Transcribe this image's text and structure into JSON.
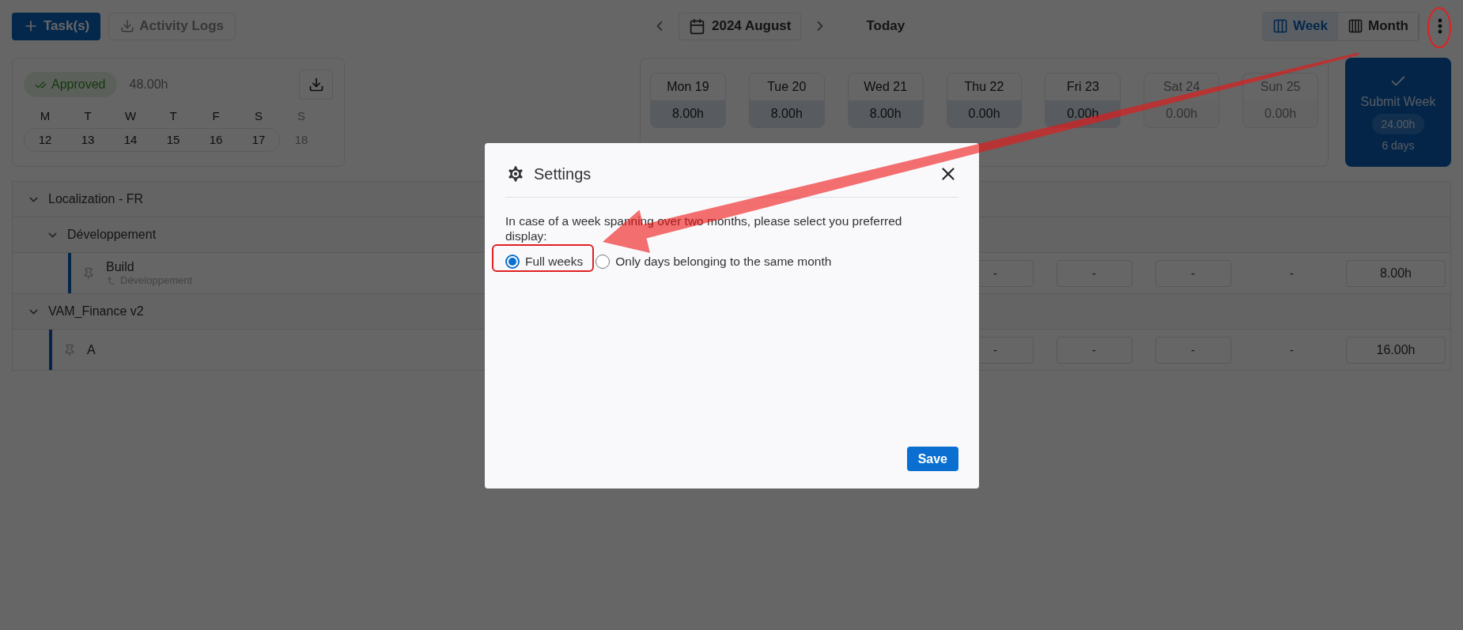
{
  "toolbar": {
    "add_button": "Task(s)",
    "logs_button": {
      "label": "Activity Logs",
      "disabled": true
    }
  },
  "date_nav": {
    "period": "2024 August",
    "today": "Today"
  },
  "views": [
    {
      "label": "Week",
      "selected": true
    },
    {
      "label": "Month",
      "selected": false
    }
  ],
  "summary": {
    "status": "Approved",
    "total": "48.00h",
    "weekdays": [
      {
        "letter": "M",
        "date": "12",
        "disabled": false
      },
      {
        "letter": "T",
        "date": "13",
        "disabled": false
      },
      {
        "letter": "W",
        "date": "14",
        "disabled": false
      },
      {
        "letter": "T",
        "date": "15",
        "disabled": false
      },
      {
        "letter": "F",
        "date": "16",
        "disabled": false
      },
      {
        "letter": "S",
        "date": "17",
        "disabled": false
      },
      {
        "letter": "S",
        "date": "18",
        "disabled": true
      }
    ]
  },
  "days": [
    {
      "label": "Mon 19",
      "hours": "8.00h",
      "disabled": false
    },
    {
      "label": "Tue 20",
      "hours": "8.00h",
      "disabled": false
    },
    {
      "label": "Wed 21",
      "hours": "8.00h",
      "disabled": false
    },
    {
      "label": "Thu 22",
      "hours": "0.00h",
      "disabled": false
    },
    {
      "label": "Fri 23",
      "hours": "0.00h",
      "disabled": false
    },
    {
      "label": "Sat 24",
      "hours": "0.00h",
      "disabled": true
    },
    {
      "label": "Sun 25",
      "hours": "0.00h",
      "disabled": true
    }
  ],
  "submit": {
    "label": "Submit Week",
    "hours": "24.00h",
    "days": "6 days"
  },
  "projects": [
    {
      "kind": "group",
      "name": "Localization - FR",
      "expanded": true,
      "children": [
        {
          "kind": "group",
          "name": "Développement",
          "expanded": true,
          "children": [
            {
              "kind": "task",
              "name": "Build",
              "parent": "Développement",
              "cells": [
                {
                  "kind": "box",
                  "value": "-"
                },
                {
                  "kind": "box",
                  "value": "-"
                },
                {
                  "kind": "box",
                  "value": "-"
                },
                {
                  "kind": "plain",
                  "value": "-"
                }
              ],
              "total": "8.00h"
            }
          ]
        }
      ]
    },
    {
      "kind": "group",
      "name": "VAM_Finance v2",
      "expanded": true,
      "children": [
        {
          "kind": "task",
          "name": "A",
          "cells": [
            {
              "kind": "box",
              "value": "-"
            },
            {
              "kind": "box",
              "value": "-"
            },
            {
              "kind": "box",
              "value": "-"
            },
            {
              "kind": "plain",
              "value": "-"
            }
          ],
          "total": "16.00h"
        }
      ]
    }
  ],
  "dialog": {
    "title": "Settings",
    "message": "In case of a week spanning over two months, please select you preferred display:",
    "options": [
      {
        "label": "Full weeks",
        "selected": true
      },
      {
        "label": "Only days belonging to the same month",
        "selected": false
      }
    ],
    "save": "Save"
  }
}
